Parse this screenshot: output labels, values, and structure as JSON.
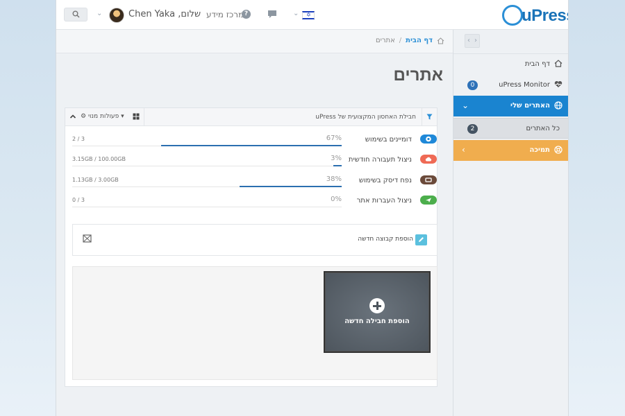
{
  "header": {
    "brand": "uPress",
    "greeting": "שלום, Chen Yaka",
    "help_label": "מרכז מידע",
    "help_glyph": "?"
  },
  "breadcrumb": {
    "home": "דף הבית",
    "separator": "/",
    "current": "אתרים"
  },
  "page_title": "אתרים",
  "panel": {
    "title": "חבילת האחסון המקצועית של uPress",
    "actions_label": "פעולות מנוי"
  },
  "stats": [
    {
      "label": "דומיינים בשימוש",
      "percent_text": "67%",
      "percent": 67,
      "value": "2 / 3",
      "color": "#1e88d8"
    },
    {
      "label": "ניצול תעבורה חודשית",
      "percent_text": "3%",
      "percent": 3,
      "value": "3.15GB / 100.00GB",
      "color": "#ef6a55"
    },
    {
      "label": "נפח דיסק בשימוש",
      "percent_text": "38%",
      "percent": 38,
      "value": "1.13GB / 3.00GB",
      "color": "#6b4a3a"
    },
    {
      "label": "ניצול העברות אתר",
      "percent_text": "0%",
      "percent": 0,
      "value": "0 / 3",
      "color": "#4cae4c"
    }
  ],
  "add_group": {
    "label": "הוספת קבוצה חדשה"
  },
  "new_package": {
    "label": "הוספת חבילה חדשה"
  },
  "sidebar": {
    "home": "דף הבית",
    "monitor": {
      "label": "uPress Monitor",
      "count": "0"
    },
    "my_sites": "האתרים שלי",
    "all_sites": {
      "label": "כל האתרים",
      "count": "2"
    },
    "support": "תמיכה"
  },
  "colors": {
    "accent": "#1a84d0",
    "support": "#f0ad4e",
    "badge": "#2e72b8",
    "progress": "#2b6fb0"
  }
}
